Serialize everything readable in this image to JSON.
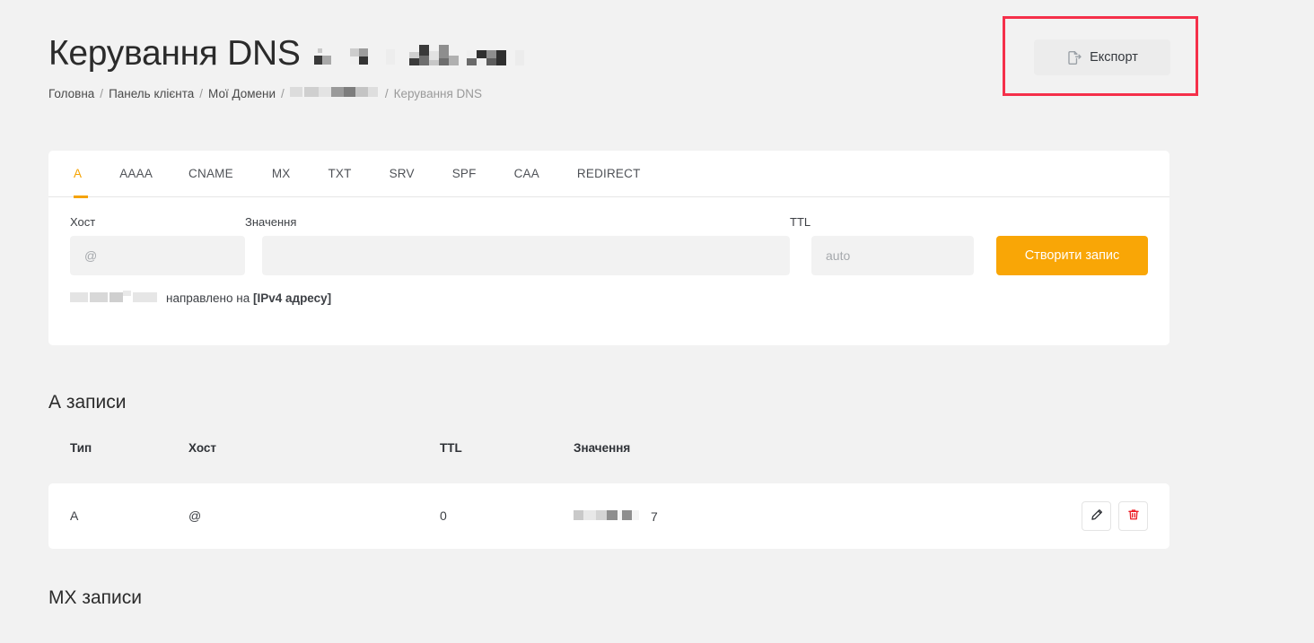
{
  "header": {
    "title": "Керування DNS",
    "title_redacted_suffix": "[redacted domain]",
    "breadcrumb": {
      "items": [
        {
          "label": "Головна",
          "kind": "link"
        },
        {
          "label": "Панель клієнта",
          "kind": "link"
        },
        {
          "label": "Мої Домени",
          "kind": "link"
        },
        {
          "label": "[redacted]",
          "kind": "redacted"
        },
        {
          "label": "Керування DNS",
          "kind": "current"
        }
      ],
      "separator": "/"
    }
  },
  "toolbar": {
    "export_label": "Експорт",
    "export_icon": "file-export-icon",
    "highlight_color": "#f5304a"
  },
  "tabs": [
    {
      "label": "A",
      "active": true
    },
    {
      "label": "AAAA",
      "active": false
    },
    {
      "label": "CNAME",
      "active": false
    },
    {
      "label": "MX",
      "active": false
    },
    {
      "label": "TXT",
      "active": false
    },
    {
      "label": "SRV",
      "active": false
    },
    {
      "label": "SPF",
      "active": false
    },
    {
      "label": "CAA",
      "active": false
    },
    {
      "label": "REDIRECT",
      "active": false
    }
  ],
  "form": {
    "host": {
      "label": "Хост",
      "value": "",
      "placeholder": "@"
    },
    "value": {
      "label": "Значення",
      "value": "",
      "placeholder": ""
    },
    "ttl": {
      "label": "TTL",
      "value": "",
      "placeholder": "auto"
    },
    "submit_label": "Створити запис",
    "hint": {
      "redacted_prefix": "[redacted host]",
      "text": "направлено на ",
      "bold": "[IPv4 адресу]"
    }
  },
  "records": {
    "a_section_title": "А записи",
    "mx_section_title": "MX записи",
    "columns": [
      "Тип",
      "Хост",
      "TTL",
      "Значення"
    ],
    "rows": [
      {
        "type": "A",
        "host": "@",
        "ttl": "0",
        "value_redacted": "[redacted ip]",
        "value_suffix": "7",
        "edit_icon": "pencil-icon",
        "delete_icon": "trash-icon"
      }
    ]
  },
  "colors": {
    "accent": "#f9a606",
    "page_bg": "#f2f2f2",
    "card_bg": "#ffffff",
    "delete": "#ec1c24"
  }
}
